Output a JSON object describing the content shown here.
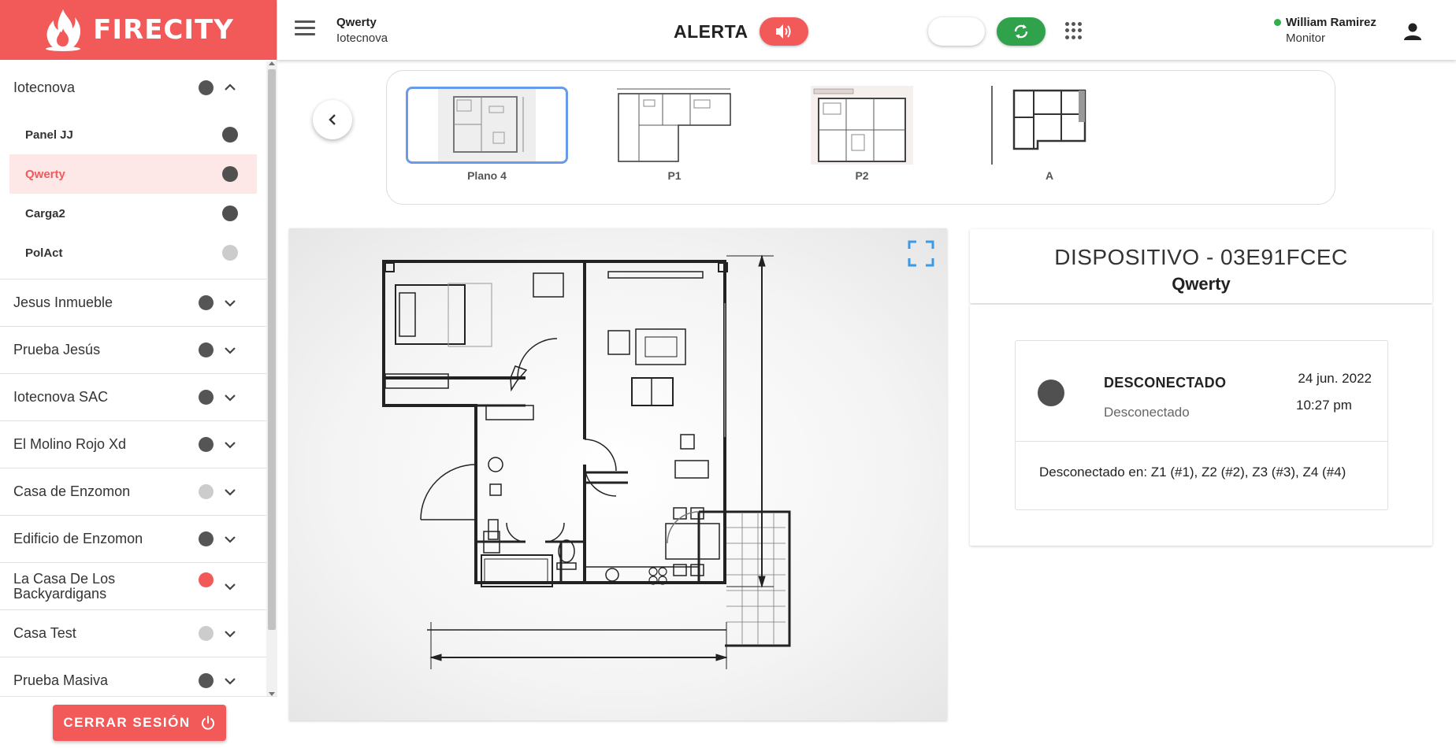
{
  "brand": {
    "name": "FIRECITY",
    "color": "#f25a5a"
  },
  "sidebar": {
    "groups": [
      {
        "name": "Iotecnova",
        "status_color": "#555555",
        "expanded": true,
        "items": [
          {
            "name": "Panel JJ",
            "status_color": "#505050",
            "active": false
          },
          {
            "name": "Qwerty",
            "status_color": "#505050",
            "active": true
          },
          {
            "name": "Carga2",
            "status_color": "#505050",
            "active": false
          },
          {
            "name": "PolAct",
            "status_color": "#cccccc",
            "active": false
          }
        ]
      },
      {
        "name": "Jesus Inmueble",
        "status_color": "#555555"
      },
      {
        "name": "Prueba Jesús",
        "status_color": "#555555"
      },
      {
        "name": "Iotecnova SAC",
        "status_color": "#555555"
      },
      {
        "name": "El Molino Rojo Xd",
        "status_color": "#555555"
      },
      {
        "name": "Casa de Enzomon",
        "status_color": "#cccccc"
      },
      {
        "name": "Edificio de Enzomon",
        "status_color": "#555555"
      },
      {
        "name": "La Casa De Los Backyardigans",
        "status_color": "#f25a5a"
      },
      {
        "name": "Casa Test",
        "status_color": "#cccccc"
      },
      {
        "name": "Prueba Masiva",
        "status_color": "#555555"
      }
    ],
    "logout_label": "CERRAR SESIÓN"
  },
  "header": {
    "building": "Qwerty",
    "company": "Iotecnova",
    "alert_label": "ALERTA",
    "user_name": "William Ramirez",
    "user_role": "Monitor",
    "online_color": "#2fb14a",
    "sync_color": "#31a24c"
  },
  "plans": [
    {
      "label": "Plano 4",
      "selected": true
    },
    {
      "label": "P1",
      "selected": false
    },
    {
      "label": "P2",
      "selected": false
    },
    {
      "label": "A",
      "selected": false
    }
  ],
  "device": {
    "title": "DISPOSITIVO - 03E91FCEC",
    "location": "Qwerty",
    "status": "DESCONECTADO",
    "status_desc": "Desconectado",
    "status_color": "#505050",
    "date": "24 jun. 2022",
    "time": "10:27 pm",
    "zones": "Desconectado en: Z1 (#1), Z2 (#2), Z3 (#3), Z4 (#4)"
  },
  "icons": {
    "menu": "menu-icon",
    "sound": "volume-icon",
    "moon": "moon-icon",
    "sync": "sync-icon",
    "apps": "apps-grid-icon",
    "user": "person-icon",
    "fullscreen": "fullscreen-icon",
    "prev": "chevron-left-icon",
    "power": "power-icon"
  }
}
